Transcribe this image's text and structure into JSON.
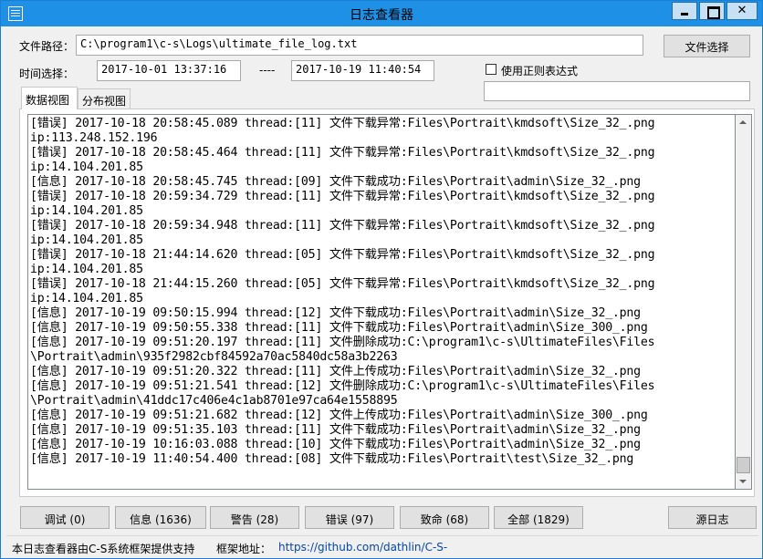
{
  "window": {
    "title": "日志查看器"
  },
  "file": {
    "path_label": "文件路径：",
    "path_value": "C:\\program1\\c-s\\Logs\\ultimate_file_log.txt",
    "choose_button": "文件选择"
  },
  "time": {
    "label": "时间选择：",
    "start": "2017-10-01 13:37:16",
    "separator": "----",
    "end": "2017-10-19 11:40:54"
  },
  "regex": {
    "checkbox_label": "使用正则表达式",
    "checked": false,
    "input_value": ""
  },
  "tabs": [
    {
      "label": "数据视图",
      "active": true
    },
    {
      "label": "分布视图",
      "active": false
    }
  ],
  "log_lines": [
    "[错误] 2017-10-18 20:58:45.089 thread:[11] 文件下载异常:Files\\Portrait\\kmdsoft\\Size_32_.png",
    "ip:113.248.152.196",
    "[错误] 2017-10-18 20:58:45.464 thread:[11] 文件下载异常:Files\\Portrait\\kmdsoft\\Size_32_.png",
    "ip:14.104.201.85",
    "[信息] 2017-10-18 20:58:45.745 thread:[09] 文件下载成功:Files\\Portrait\\admin\\Size_32_.png",
    "[错误] 2017-10-18 20:59:34.729 thread:[11] 文件下载异常:Files\\Portrait\\kmdsoft\\Size_32_.png",
    "ip:14.104.201.85",
    "[错误] 2017-10-18 20:59:34.948 thread:[11] 文件下载异常:Files\\Portrait\\kmdsoft\\Size_32_.png",
    "ip:14.104.201.85",
    "[错误] 2017-10-18 21:44:14.620 thread:[05] 文件下载异常:Files\\Portrait\\kmdsoft\\Size_32_.png",
    "ip:14.104.201.85",
    "[错误] 2017-10-18 21:44:15.260 thread:[05] 文件下载异常:Files\\Portrait\\kmdsoft\\Size_32_.png",
    "ip:14.104.201.85",
    "[信息] 2017-10-19 09:50:15.994 thread:[12] 文件下载成功:Files\\Portrait\\admin\\Size_32_.png",
    "[信息] 2017-10-19 09:50:55.338 thread:[11] 文件下载成功:Files\\Portrait\\admin\\Size_300_.png",
    "[信息] 2017-10-19 09:51:20.197 thread:[11] 文件删除成功:C:\\program1\\c-s\\UltimateFiles\\Files",
    "\\Portrait\\admin\\935f2982cbf84592a70ac5840dc58a3b2263",
    "[信息] 2017-10-19 09:51:20.322 thread:[11] 文件上传成功:Files\\Portrait\\admin\\Size_32_.png",
    "[信息] 2017-10-19 09:51:21.541 thread:[12] 文件删除成功:C:\\program1\\c-s\\UltimateFiles\\Files",
    "\\Portrait\\admin\\41ddc17c406e4c1ab8701e97ca64e1558895",
    "[信息] 2017-10-19 09:51:21.682 thread:[12] 文件上传成功:Files\\Portrait\\admin\\Size_300_.png",
    "[信息] 2017-10-19 09:51:35.103 thread:[11] 文件下载成功:Files\\Portrait\\admin\\Size_32_.png",
    "[信息] 2017-10-19 10:16:03.088 thread:[10] 文件下载成功:Files\\Portrait\\admin\\Size_32_.png",
    "[信息] 2017-10-19 11:40:54.400 thread:[08] 文件下载成功:Files\\Portrait\\test\\Size_32_.png"
  ],
  "filter_buttons": {
    "debug": "调试 (0)",
    "info": "信息 (1636)",
    "warn": "警告 (28)",
    "error": "错误 (97)",
    "fatal": "致命 (68)",
    "all": "全部 (1829)"
  },
  "source_log_button": "源日志",
  "status": {
    "provided_by": "本日志查看器由C-S系统框架提供支持",
    "address_label": "框架地址：",
    "address_url": "https://github.com/dathlin/C-S-"
  }
}
